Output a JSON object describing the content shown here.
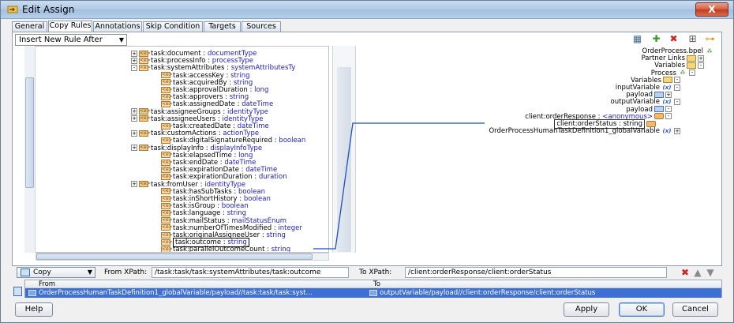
{
  "window": {
    "title": "Edit Assign",
    "close_label": "X"
  },
  "tabs": [
    {
      "label": "General"
    },
    {
      "label": "Copy Rules",
      "active": true
    },
    {
      "label": "Annotations"
    },
    {
      "label": "Skip Condition"
    },
    {
      "label": "Targets"
    },
    {
      "label": "Sources"
    }
  ],
  "insert_rule": {
    "value": "Insert New Rule After"
  },
  "toolbar": {
    "icons": [
      "auto-map-icon",
      "add-rule-icon",
      "delete-icon",
      "expression-icon",
      "link-icon"
    ]
  },
  "left_tree": [
    {
      "name": "task:document",
      "type": "documentType",
      "exp": "+",
      "complex": true
    },
    {
      "name": "task:processInfo",
      "type": "processType",
      "exp": "+",
      "complex": false
    },
    {
      "name": "task:systemAttributes",
      "type": "systemAttributesTy",
      "exp": "-",
      "complex": false
    },
    {
      "name": "task:accessKey",
      "type": "string"
    },
    {
      "name": "task:acquiredBy",
      "type": "string"
    },
    {
      "name": "task:approvalDuration",
      "type": "long"
    },
    {
      "name": "task:approvers",
      "type": "string"
    },
    {
      "name": "task:assignedDate",
      "type": "dateTime"
    },
    {
      "name": "task:assigneeGroups",
      "type": "identityType",
      "exp": "+",
      "complex": true
    },
    {
      "name": "task:assigneeUsers",
      "type": "identityType",
      "exp": "+",
      "complex": true
    },
    {
      "name": "task:createdDate",
      "type": "dateTime"
    },
    {
      "name": "task:customActions",
      "type": "actionType",
      "exp": "+",
      "complex": true
    },
    {
      "name": "task:digitalSignatureRequired",
      "type": "boolean"
    },
    {
      "name": "task:displayInfo",
      "type": "displayInfoType",
      "exp": "+",
      "complex": true
    },
    {
      "name": "task:elapsedTime",
      "type": "long"
    },
    {
      "name": "task:endDate",
      "type": "dateTime"
    },
    {
      "name": "task:expirationDate",
      "type": "dateTime"
    },
    {
      "name": "task:expirationDuration",
      "type": "duration"
    },
    {
      "name": "task:fromUser",
      "type": "identityType",
      "exp": "+",
      "complex": true
    },
    {
      "name": "task:hasSubTasks",
      "type": "boolean"
    },
    {
      "name": "task:inShortHistory",
      "type": "boolean"
    },
    {
      "name": "task:isGroup",
      "type": "boolean"
    },
    {
      "name": "task:language",
      "type": "string"
    },
    {
      "name": "task:mailStatus",
      "type": "mailStatusEnum"
    },
    {
      "name": "task:numberOfTimesModified",
      "type": "integer"
    },
    {
      "name": "task:originalAssigneeUser",
      "type": "string"
    },
    {
      "name": "task:outcome",
      "type": "string",
      "selected": true
    },
    {
      "name": "task:parallelOutcomeCount",
      "type": "string"
    }
  ],
  "right_tree": [
    {
      "text": "OrderProcess.bpel",
      "icon": "bpel"
    },
    {
      "text": "Partner Links",
      "icon": "folder",
      "exp": "+"
    },
    {
      "text": "Variables",
      "icon": "folder",
      "exp": "-"
    },
    {
      "text": "Process",
      "icon": "process",
      "exp": "-"
    },
    {
      "text": "Variables",
      "icon": "folder",
      "exp": "-"
    },
    {
      "text": "inputVariable",
      "icon": "var",
      "exp": "-"
    },
    {
      "text": "payload",
      "icon": "payload",
      "exp": "+"
    },
    {
      "text": "outputVariable",
      "icon": "var",
      "exp": "-"
    },
    {
      "text": "payload",
      "icon": "payload",
      "exp": "-"
    },
    {
      "text": "client:orderResponse : ",
      "type": "<anonymous>",
      "icon": "elem",
      "exp": "-"
    },
    {
      "text": "client:orderStatus : string",
      "icon": "elem",
      "selected": true
    },
    {
      "text": "OrderProcessHumanTaskDefinition1_globalVariable",
      "icon": "var",
      "exp": "+"
    }
  ],
  "copy_type": {
    "value": "Copy"
  },
  "from_xpath": {
    "label": "From XPath:",
    "value": "/task:task/task:systemAttributes/task:outcome"
  },
  "to_xpath": {
    "label": "To XPath:",
    "value": "/client:orderResponse/client:orderStatus"
  },
  "rules": {
    "headers": {
      "from": "From",
      "to": "To"
    },
    "rows": [
      {
        "from": "OrderProcessHumanTaskDefinition1_globalVariable/payload//task:task/task:syst...",
        "to": "outputVariable/payload//client:orderResponse/client:orderStatus"
      }
    ]
  },
  "footer": {
    "help": "Help",
    "apply": "Apply",
    "ok": "OK",
    "cancel": "Cancel"
  }
}
